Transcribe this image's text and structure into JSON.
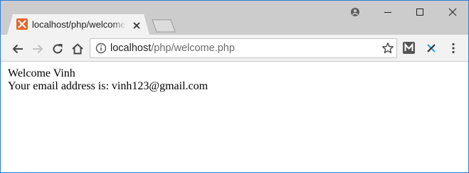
{
  "tab": {
    "title": "localhost/php/welcome.php",
    "favicon": "xampp-icon"
  },
  "address_bar": {
    "host": "localhost",
    "path": "/php/welcome.php"
  },
  "page": {
    "welcome_line": "Welcome Vinh",
    "email_line": "Your email address is: vinh123@gmail.com"
  },
  "colors": {
    "window_border": "#2b7bd6",
    "tab_strip": "#cccccc",
    "active_tab": "#f2f2f2",
    "favicon_bg": "#e2652a"
  }
}
